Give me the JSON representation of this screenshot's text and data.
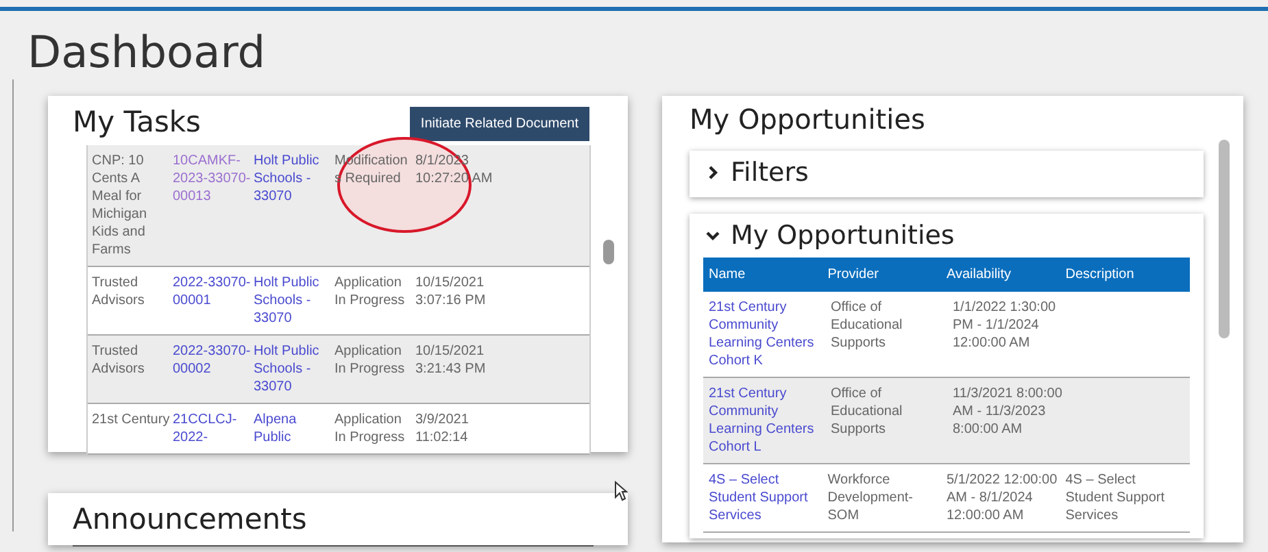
{
  "page": {
    "title": "Dashboard"
  },
  "my_tasks": {
    "title": "My Tasks",
    "action_button": "Initiate Related Document",
    "rows": [
      {
        "cells": [
          "CNP: 10 Cents A Meal for Michigan Kids and Farms",
          "10CAMKF-2023-33070-00013",
          "Holt Public Schools - 33070",
          "Modifications Required",
          "8/1/2023 10:27:20 AM"
        ],
        "visited": true
      },
      {
        "cells": [
          "Trusted Advisors",
          "2022-33070-00001",
          "Holt Public Schools - 33070",
          "Application In Progress",
          "10/15/2021 3:07:16 PM"
        ],
        "visited": false
      },
      {
        "cells": [
          "Trusted Advisors",
          "2022-33070-00002",
          "Holt Public Schools - 33070",
          "Application In Progress",
          "10/15/2021 3:21:43 PM"
        ],
        "visited": false
      },
      {
        "cells": [
          "21st Century",
          "21CCLCJ-2022-",
          "Alpena Public",
          "Application In Progress",
          "3/9/2021 11:02:14"
        ],
        "visited": false
      }
    ]
  },
  "announcements": {
    "title": "Announcements"
  },
  "my_opportunities": {
    "title": "My Opportunities",
    "sections": [
      {
        "title": "Filters",
        "expanded": false
      },
      {
        "title": "My Opportunities",
        "expanded": true
      }
    ],
    "columns": [
      "Name",
      "Provider",
      "Availability",
      "Description"
    ],
    "rows": [
      {
        "name": "21st Century Community Learning Centers Cohort K",
        "provider": "Office of Educational Supports",
        "availability": "1/1/2022 1:30:00 PM - 1/1/2024 12:00:00 AM"
      },
      {
        "name": "21st Century Community Learning Centers Cohort L",
        "provider": "Office of Educational Supports",
        "availability": "11/3/2021 8:00:00 AM - 11/3/2023 8:00:00 AM"
      },
      {
        "name": "4S – Select Student Support Services",
        "provider": "Workforce Development-SOM",
        "availability": "5/1/2022 12:00:00 AM - 8/1/2024 12:00:00 AM",
        "description": "4S – Select Student Support Services"
      }
    ]
  }
}
